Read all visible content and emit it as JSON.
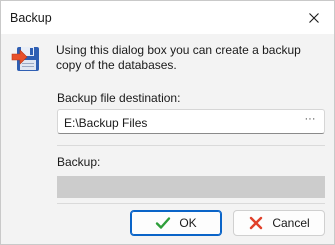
{
  "window": {
    "title": "Backup"
  },
  "icons": {
    "app": "floppy-disk-arrow-icon",
    "close": "close-icon",
    "ok": "checkmark-icon",
    "cancel": "x-icon"
  },
  "intro": {
    "text": "Using this dialog box you can create a backup copy of the databases."
  },
  "destination": {
    "label": "Backup file destination:",
    "value": "E:\\Backup Files",
    "browse_label": "···"
  },
  "backup": {
    "label": "Backup:",
    "progress": 0
  },
  "buttons": {
    "ok_label": "OK",
    "cancel_label": "Cancel"
  },
  "colors": {
    "accent": "#0a64c8",
    "progress_track": "#cccccc",
    "ok_check": "#2e9e3a",
    "cancel_x": "#e0402a"
  }
}
